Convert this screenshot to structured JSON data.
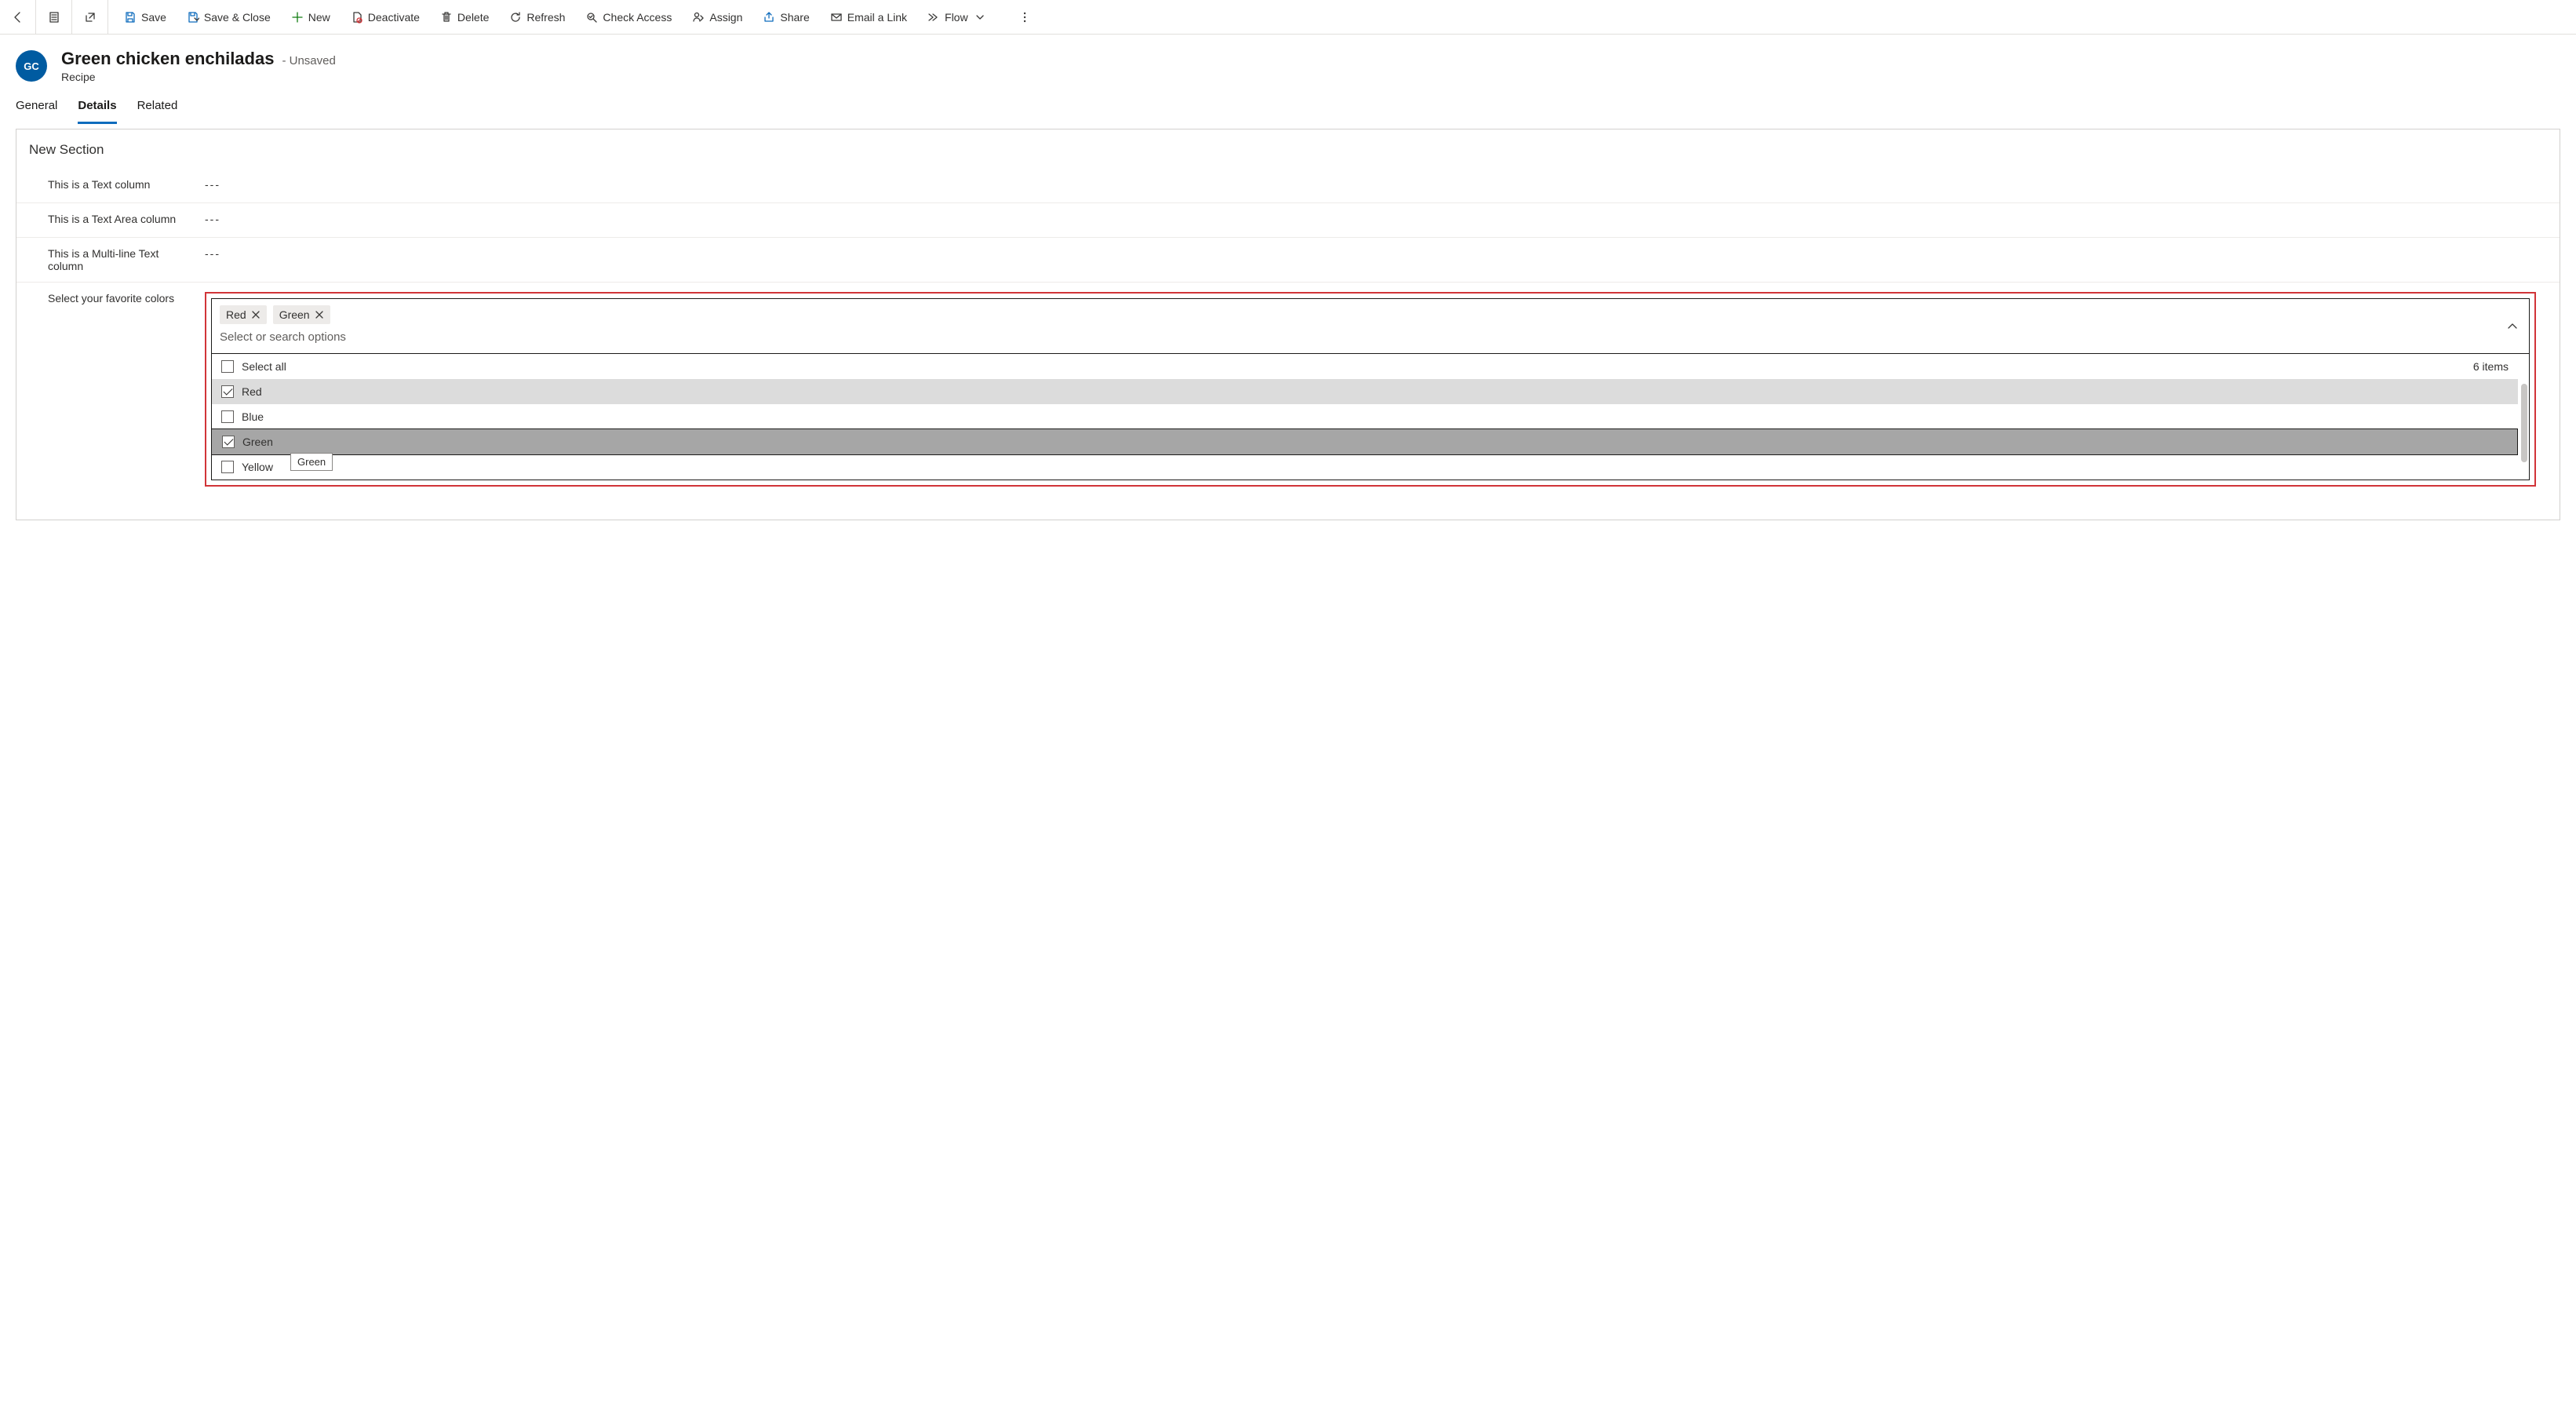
{
  "toolbar": {
    "save": "Save",
    "save_close": "Save & Close",
    "new": "New",
    "deactivate": "Deactivate",
    "delete": "Delete",
    "refresh": "Refresh",
    "check_access": "Check Access",
    "assign": "Assign",
    "share": "Share",
    "email_link": "Email a Link",
    "flow": "Flow"
  },
  "header": {
    "avatar": "GC",
    "title": "Green chicken enchiladas",
    "status": "- Unsaved",
    "subtitle": "Recipe"
  },
  "tabs": {
    "general": "General",
    "details": "Details",
    "related": "Related"
  },
  "form": {
    "section_title": "New Section",
    "f_text_label": "This is a Text column",
    "f_text_value": "---",
    "f_textarea_label": "This is a Text Area column",
    "f_textarea_value": "---",
    "f_multiline_label": "This is a Multi-line Text column",
    "f_multiline_value": "---",
    "f_colors_label": "Select your favorite colors"
  },
  "dropdown": {
    "pills": {
      "red": "Red",
      "green": "Green"
    },
    "placeholder": "Select or search options",
    "select_all": "Select all",
    "count": "6 items",
    "options": {
      "red": "Red",
      "blue": "Blue",
      "green": "Green",
      "yellow": "Yellow"
    },
    "tooltip": "Green"
  }
}
